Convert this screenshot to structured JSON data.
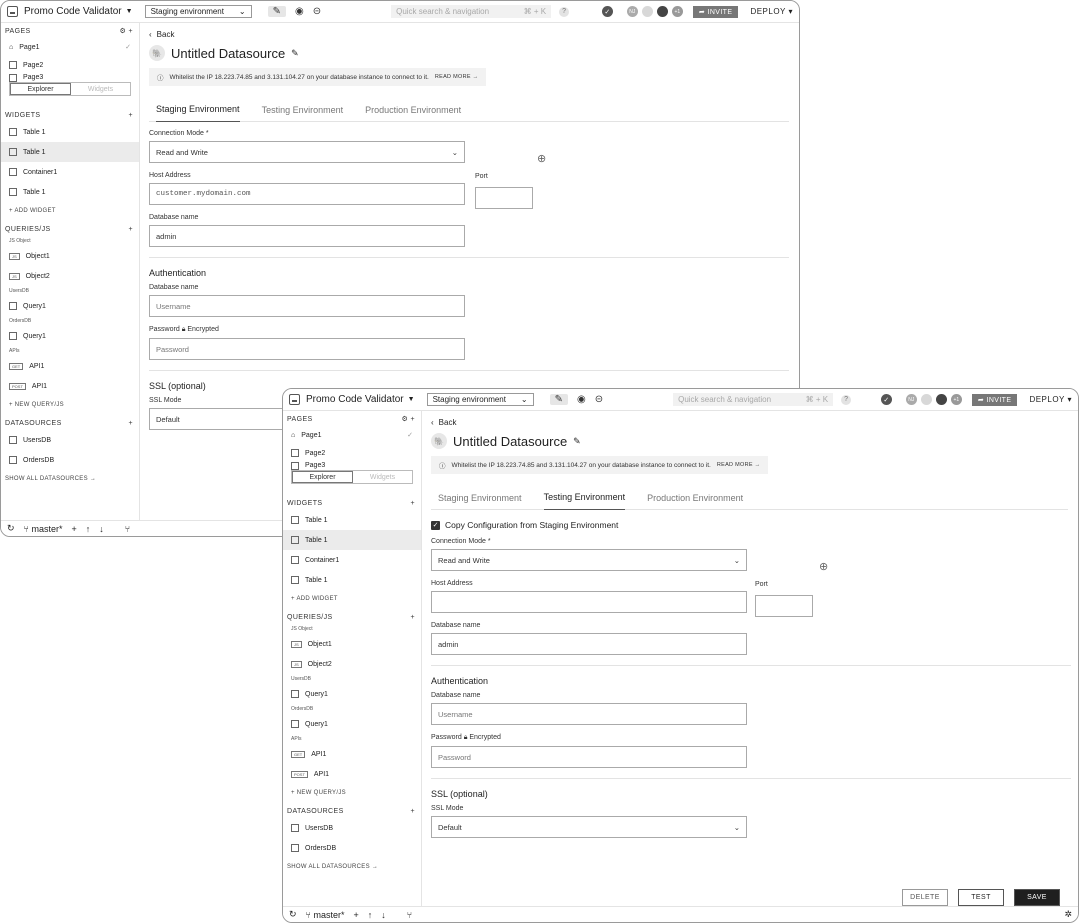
{
  "topbar": {
    "app_name": "Promo Code Validator",
    "env_select": "Staging environment",
    "search_placeholder": "Quick search & navigation",
    "search_shortcut": "⌘ + K",
    "help": "?",
    "avatars": [
      "NJ",
      "+1"
    ],
    "invite": "INVITE",
    "deploy": "DEPLOY"
  },
  "sidebar": {
    "pages_header": "PAGES",
    "pages": [
      "Page1",
      "Page2",
      "Page3"
    ],
    "explorer_tabs": [
      "Explorer",
      "Widgets"
    ],
    "widgets_header": "WIDGETS",
    "widgets": [
      "Table 1",
      "Table 1",
      "Container1",
      "Table 1"
    ],
    "add_widget": "+ ADD WIDGET",
    "queries_header": "QUERIES/JS",
    "groups": [
      {
        "label": "JS Object",
        "items": [
          {
            "badge": "JS",
            "name": "Object1"
          },
          {
            "badge": "JS",
            "name": "Object2"
          }
        ]
      },
      {
        "label": "UsersDB",
        "items": [
          {
            "badge": "",
            "name": "Query1"
          }
        ]
      },
      {
        "label": "OrdersDB",
        "items": [
          {
            "badge": "",
            "name": "Query1"
          }
        ]
      },
      {
        "label": "APIs",
        "items": [
          {
            "badge": "GET",
            "name": "API1"
          },
          {
            "badge": "POST",
            "name": "API1"
          }
        ]
      }
    ],
    "new_query": "+ NEW QUERY/JS",
    "datasources_header": "DATASOURCES",
    "datasources": [
      "UsersDB",
      "OrdersDB"
    ],
    "show_all": "SHOW ALL DATASOURCES →"
  },
  "bottombar": {
    "branch": "master*"
  },
  "main": {
    "back": "Back",
    "title": "Untitled Datasource",
    "note": "Whitelist the IP 18.223.74.85 and 3.131.104.27 on your database instance to connect to it.",
    "note_link": "READ MORE →",
    "tabs": [
      "Staging Environment",
      "Testing Environment",
      "Production Environment"
    ],
    "copy_config": "Copy Configuration from Staging Environment",
    "connection_mode_label": "Connection Mode *",
    "connection_mode": "Read and Write",
    "host_label": "Host Address",
    "host_back": "customer.mydomain.com",
    "port_label": "Port",
    "dbname_label": "Database name",
    "dbname": "admin",
    "auth_title": "Authentication",
    "auth_dbname_label": "Database name",
    "username_ph": "Username",
    "password_label": "Password",
    "encrypted": "Encrypted",
    "password_ph": "Password",
    "ssl_title": "SSL (optional)",
    "ssl_mode_label": "SSL Mode",
    "ssl_mode": "Default",
    "delete": "DELETE",
    "test": "TEST",
    "save": "SAVE"
  }
}
